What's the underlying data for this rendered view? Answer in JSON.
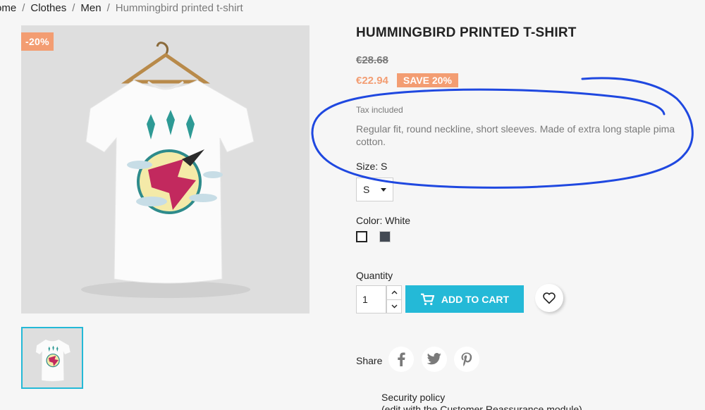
{
  "breadcrumb": {
    "items": [
      "ome",
      "Clothes",
      "Men"
    ],
    "current": "Hummingbird printed t-shirt",
    "separator": "/"
  },
  "product": {
    "discount_flag": "-20%",
    "title": "HUMMINGBIRD PRINTED T-SHIRT",
    "regular_price": "€28.68",
    "current_price": "€22.94",
    "save_badge": "SAVE 20%",
    "tax_label": "Tax included",
    "description": "Regular fit, round neckline, short sleeves. Made of extra long staple pima cotton."
  },
  "variants": {
    "size_label": "Size: S",
    "size_selected": "S",
    "color_label": "Color: White",
    "colors": [
      {
        "name": "White",
        "hex": "#ffffff"
      },
      {
        "name": "Dark grey",
        "hex": "#434a54"
      }
    ]
  },
  "purchase": {
    "quantity_label": "Quantity",
    "quantity_value": "1",
    "add_to_cart_label": "ADD TO CART"
  },
  "share": {
    "label": "Share",
    "networks": [
      "facebook-icon",
      "twitter-icon",
      "pinterest-icon"
    ]
  },
  "reassurance": {
    "title": "Security policy",
    "subtitle": "(edit with the Customer Reassurance module)"
  },
  "colors": {
    "accent": "#24b9d7",
    "sale": "#f39d72",
    "annotation": "#1f48e0"
  }
}
